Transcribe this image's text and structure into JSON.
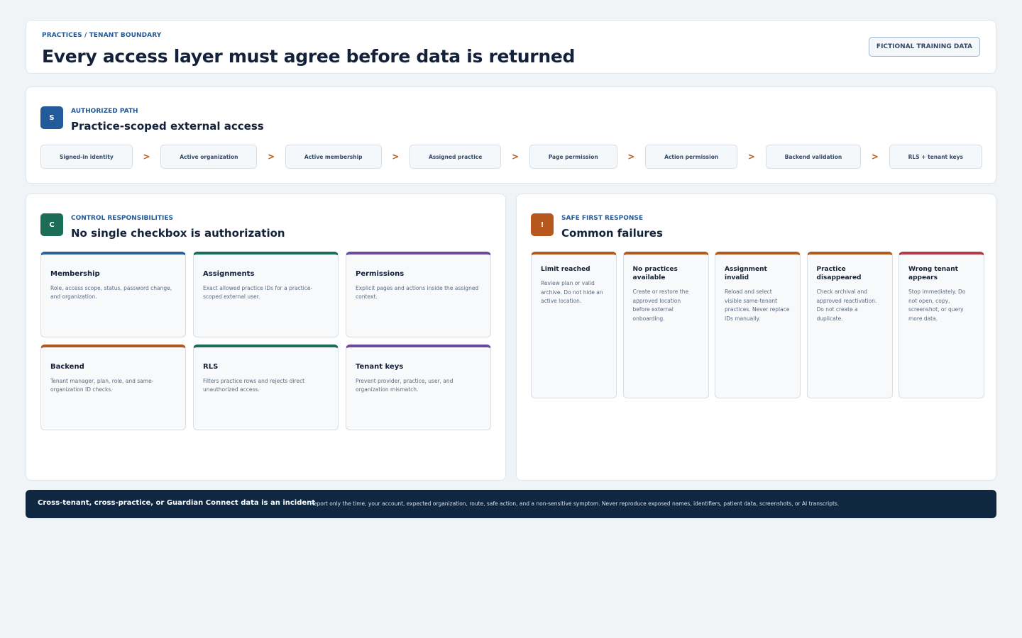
{
  "header": {
    "breadcrumb": "PRACTICES / TENANT BOUNDARY",
    "title": "Every access layer must agree before data is returned",
    "badge": "FICTIONAL TRAINING DATA"
  },
  "path": {
    "icon_letter": "S",
    "icon_color": "#235a9a",
    "kicker": "AUTHORIZED PATH",
    "title": "Practice-scoped external access",
    "arrow": ">",
    "steps": [
      "Signed-in identity",
      "Active organization",
      "Active membership",
      "Assigned practice",
      "Page permission",
      "Action permission",
      "Backend validation",
      "RLS + tenant keys"
    ]
  },
  "control": {
    "icon_letter": "C",
    "icon_color": "#1b6d55",
    "kicker": "CONTROL RESPONSIBILITIES",
    "title": "No single checkbox is authorization",
    "cards": [
      {
        "title": "Membership",
        "text": "Role, access scope, status, password change, and organization.",
        "color": "#2a5f9c"
      },
      {
        "title": "Assignments",
        "text": "Exact allowed practice IDs for a practice-scoped external user.",
        "color": "#1b6d55"
      },
      {
        "title": "Permissions",
        "text": "Explicit pages and actions inside the assigned context.",
        "color": "#6a4a9c"
      },
      {
        "title": "Backend",
        "text": "Tenant manager, plan, role, and same-organization ID checks.",
        "color": "#b1591f"
      },
      {
        "title": "RLS",
        "text": "Filters practice rows and rejects direct unauthorized access.",
        "color": "#1b6d55"
      },
      {
        "title": "Tenant keys",
        "text": "Prevent provider, practice, user, and organization mismatch.",
        "color": "#6a4a9c"
      }
    ]
  },
  "failures": {
    "icon_letter": "!",
    "icon_color": "#b8571d",
    "kicker": "SAFE FIRST RESPONSE",
    "title": "Common failures",
    "cards": [
      {
        "title": "Limit reached",
        "text": "Review plan or valid archive. Do not hide an active location.",
        "color": "#b1591f"
      },
      {
        "title": "No practices available",
        "text": "Create or restore the approved location before external onboarding.",
        "color": "#b1591f"
      },
      {
        "title": "Assignment invalid",
        "text": "Reload and select visible same-tenant practices. Never replace IDs manually.",
        "color": "#b1591f"
      },
      {
        "title": "Practice disappeared",
        "text": "Check archival and approved reactivation. Do not create a duplicate.",
        "color": "#b1591f"
      },
      {
        "title": "Wrong tenant appears",
        "text": "Stop immediately. Do not open, copy, screenshot, or query more data.",
        "color": "#b23a4a"
      }
    ]
  },
  "banner": {
    "title": "Cross-tenant, cross-practice, or Guardian Connect data is an incident",
    "text": "Report only the time, your account, expected organization, route, safe action, and a non-sensitive symptom. Never reproduce exposed names, identifiers, patient data, screenshots, or AI transcripts."
  }
}
